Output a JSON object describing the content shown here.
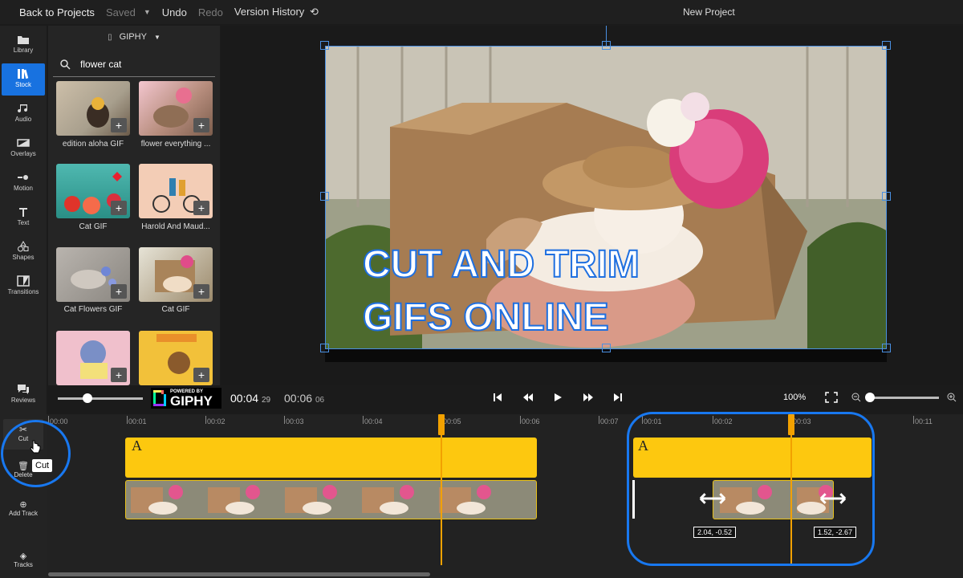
{
  "topbar": {
    "back": "Back to Projects",
    "saved": "Saved",
    "undo": "Undo",
    "redo": "Redo",
    "version_history": "Version History",
    "project_title": "New Project"
  },
  "rail": {
    "items": [
      {
        "label": "Library",
        "icon": "library-icon"
      },
      {
        "label": "Stock",
        "icon": "stock-icon",
        "active": true
      },
      {
        "label": "Audio",
        "icon": "audio-icon"
      },
      {
        "label": "Overlays",
        "icon": "overlays-icon"
      },
      {
        "label": "Motion",
        "icon": "motion-icon"
      },
      {
        "label": "Text",
        "icon": "text-icon"
      },
      {
        "label": "Shapes",
        "icon": "shapes-icon"
      },
      {
        "label": "Transitions",
        "icon": "transitions-icon"
      }
    ],
    "reviews": "Reviews"
  },
  "panel": {
    "source": "GIPHY",
    "search_value": "flower cat",
    "results": [
      {
        "label": "edition aloha GIF"
      },
      {
        "label": "flower everything ..."
      },
      {
        "label": "Cat GIF"
      },
      {
        "label": "Harold And Maud..."
      },
      {
        "label": "Cat Flowers GIF"
      },
      {
        "label": "Cat GIF"
      },
      {
        "label": ""
      },
      {
        "label": ""
      }
    ],
    "giphy_badge_top": "POWERED BY",
    "giphy_badge": "GIPHY"
  },
  "preview": {
    "caption_line1": "CUT AND TRIM",
    "caption_line2": "GIFS ONLINE"
  },
  "controls": {
    "current_time": "00:04",
    "current_frames": "29",
    "total_time": "00:06",
    "total_frames": "06",
    "zoom": "100%"
  },
  "timeline": {
    "tools": {
      "cut": "Cut",
      "tooltip": "Cut",
      "delete": "Delete",
      "add_track": "Add Track",
      "tracks": "Tracks"
    },
    "ruler_left": [
      "00:00",
      "00:01",
      "00:02",
      "00:03",
      "00:04",
      "00:05",
      "00:06",
      "00:07"
    ],
    "ruler_right": [
      "00:01",
      "00:02",
      "00:03",
      "00:11"
    ],
    "text_clip_letter": "A",
    "tag_left": "2.04, -0.52",
    "tag_right": "1.52, -2.67"
  },
  "colors": {
    "accent": "#1872e0",
    "track_yellow": "#fdc80f",
    "playhead": "#f2a100"
  }
}
